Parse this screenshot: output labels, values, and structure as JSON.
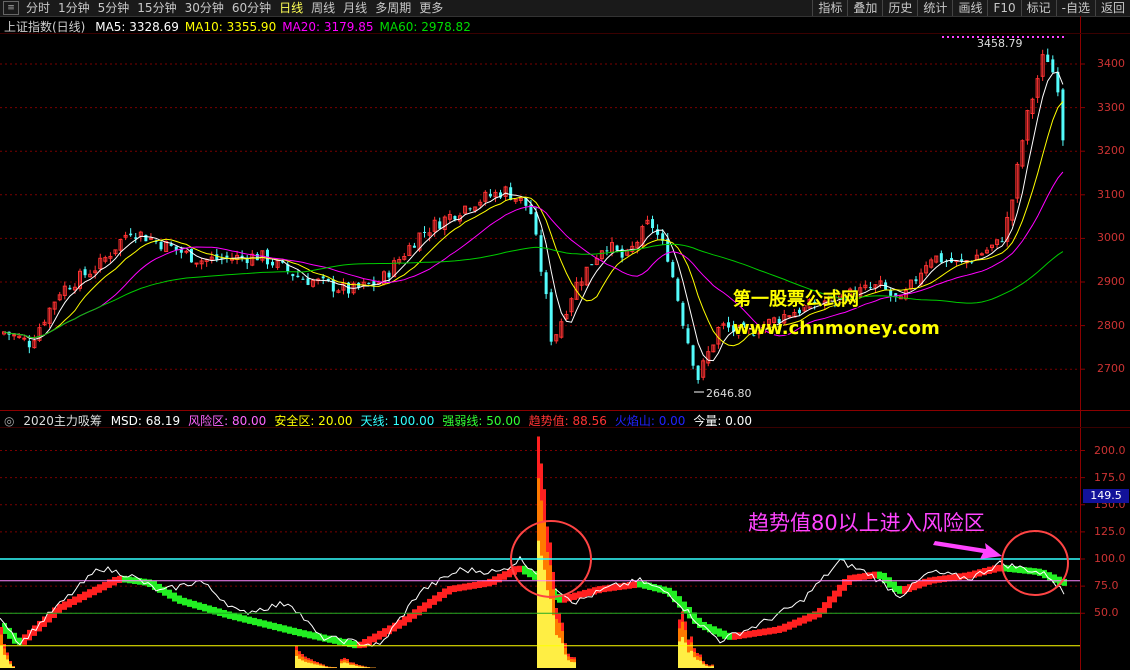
{
  "toolbar": {
    "menu_glyph": "≡",
    "periods": [
      "分时",
      "1分钟",
      "5分钟",
      "15分钟",
      "30分钟",
      "60分钟",
      "日线",
      "周线",
      "月线",
      "多周期",
      "更多"
    ],
    "active_period": "日线",
    "right_buttons": [
      "指标",
      "叠加",
      "历史",
      "统计",
      "画线",
      "F10",
      "标记",
      "-自选",
      "返回"
    ]
  },
  "main_chart": {
    "title": "上证指数(日线)",
    "ma": [
      {
        "label": "MA5: 3328.69",
        "color": "#ffffff"
      },
      {
        "label": "MA10: 3355.90",
        "color": "#ffff00"
      },
      {
        "label": "MA20: 3179.85",
        "color": "#ff00ff"
      },
      {
        "label": "MA60: 2978.82",
        "color": "#00dd00"
      }
    ],
    "y_ticks": [
      "3400",
      "3300",
      "3200",
      "3100",
      "3000",
      "2900",
      "2800",
      "2700"
    ],
    "high_label": "3458.79",
    "low_label": "2646.80",
    "watermark_1": "第一股票公式网",
    "watermark_2": "www.chnmoney.com"
  },
  "indicator": {
    "name": "2020主力吸筹",
    "params": [
      {
        "label": "MSD: 68.19",
        "color": "#ffffff"
      },
      {
        "label": "风险区: 80.00",
        "color": "#ff66ff"
      },
      {
        "label": "安全区: 20.00",
        "color": "#ffff00"
      },
      {
        "label": "天线: 100.00",
        "color": "#33ffff"
      },
      {
        "label": "强弱线: 50.00",
        "color": "#33ff33"
      },
      {
        "label": "趋势值: 88.56",
        "color": "#ff3333"
      },
      {
        "label": "火焰山: 0.00",
        "color": "#2222ff"
      },
      {
        "label": "今量: 0.00",
        "color": "#ffffff"
      }
    ],
    "y_ticks": [
      "200.0",
      "175.0",
      "150.0",
      "125.0",
      "100.0",
      "75.0",
      "50.0"
    ],
    "current_value": "149.5",
    "annotation": "趋势值80以上进入风险区"
  },
  "colors": {
    "up": "#ff3232",
    "down": "#54fcfc",
    "ma5": "#ffffff",
    "ma10": "#ffff00",
    "ma20": "#ff00ff",
    "ma60": "#00cc00",
    "grid": "#7a0000",
    "axis": "#8b0000",
    "annotation": "#ff44ff",
    "circle": "#ff4444"
  }
}
